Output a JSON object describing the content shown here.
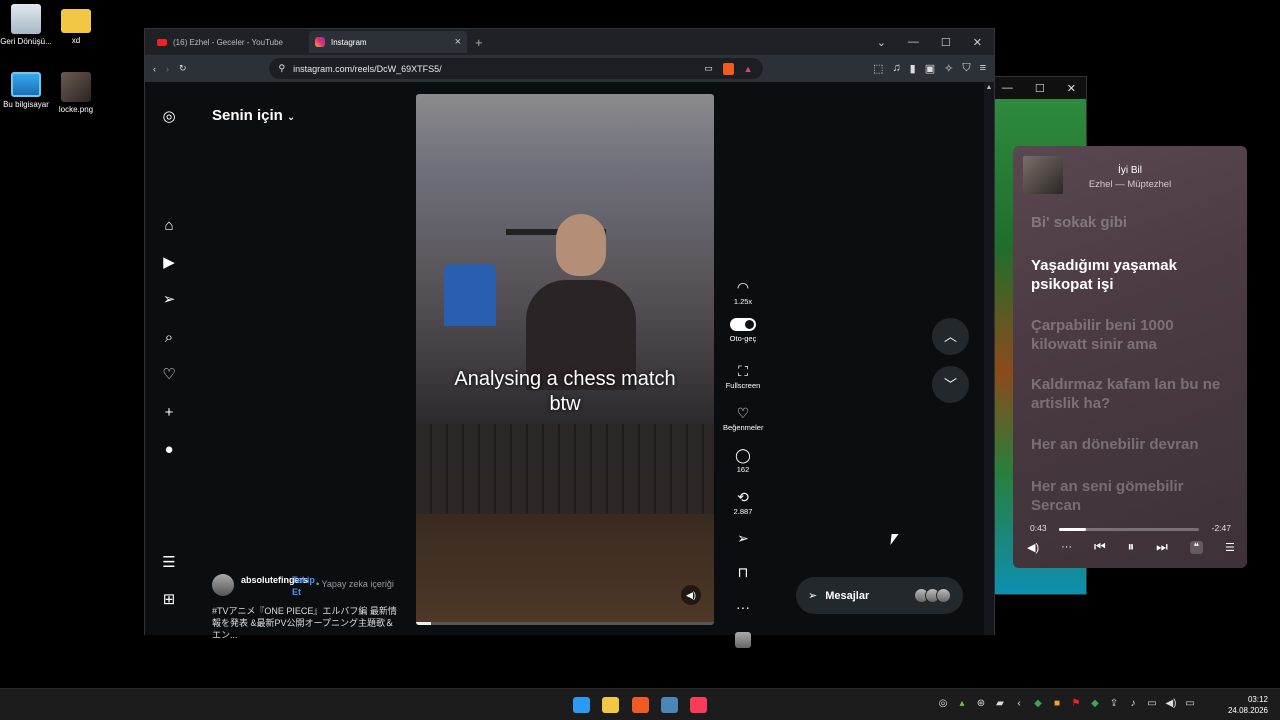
{
  "desktop": {
    "icons": [
      {
        "label": "Geri Dönüşü..."
      },
      {
        "label": "xd"
      },
      {
        "label": "Bu bilgisayar"
      },
      {
        "label": "locke.png"
      }
    ]
  },
  "browser": {
    "tabs": [
      {
        "label": "(16) Ezhel - Geceler - YouTube"
      },
      {
        "label": "Instagram"
      }
    ],
    "new_tab": "+",
    "url": "instagram.com/reels/DcW_69XTFS5/",
    "window_controls": {
      "menu": "⌄",
      "minimize": "—",
      "maximize": "☐",
      "close": "✕"
    },
    "toolbar_icons": [
      "extensions-icon",
      "music-icon",
      "sidebar-icon",
      "wallet-icon",
      "leo-ai-icon",
      "vpn-icon",
      "menu-icon"
    ]
  },
  "instagram": {
    "feed_title": "Senin için",
    "video": {
      "caption_line1": "Analysing a chess match",
      "caption_line2": "btw",
      "progress": 0.05
    },
    "post": {
      "username": "absolutefingers",
      "follow": "Takip Et",
      "ai_label": "• Yapay zeka içeriği",
      "caption": "#TVアニメ『ONE PIECE』エルバフ編 最新情報を発表 &最新PV公開オープニング主題歌＆エン..."
    },
    "actions": {
      "speed": "1.25x",
      "autoplay": "Oto-geç",
      "fullscreen": "Fullscreen",
      "likes": "Beğenmeler",
      "comments": "162",
      "reposts": "2.887"
    },
    "messages_label": "Mesajlar"
  },
  "music": {
    "title": "İyi Bil",
    "artist": "Ezhel — Müptezhel",
    "lyrics": [
      "Bi' sokak gibi",
      "Yaşadığımı yaşamak psikopat işi",
      "Çarpabilir beni 1000 kilowatt sinir ama",
      "Kaldırmaz kafam lan bu ne artislik ha?",
      "Her an dönebilir devran",
      "Her an seni gömebilir Sercan"
    ],
    "current_lyric_index": 1,
    "time_elapsed": "0:43",
    "time_remaining": "-2:47",
    "progress": 0.19
  },
  "clock": {
    "time": "03:12",
    "date": "24.08.2026"
  },
  "colors": {
    "accent_blue": "#4a90f5",
    "youtube_red": "#ee2222",
    "music_bg": "#4b3a42"
  }
}
